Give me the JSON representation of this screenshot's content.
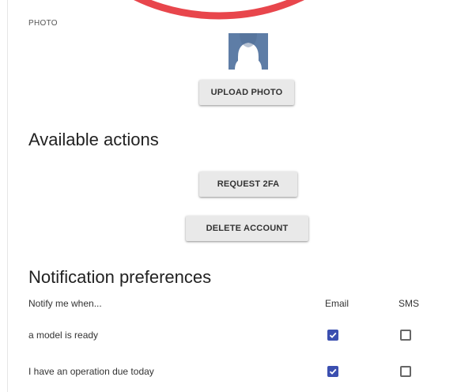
{
  "photo_section": {
    "label": "PHOTO",
    "avatar_icon": "person-silhouette-icon",
    "upload_label": "UPLOAD PHOTO"
  },
  "actions_section": {
    "heading": "Available actions",
    "request_2fa_label": "REQUEST 2FA",
    "delete_account_label": "DELETE ACCOUNT"
  },
  "notifications": {
    "heading": "Notification preferences",
    "columns": {
      "notify": "Notify me when...",
      "email": "Email",
      "sms": "SMS"
    },
    "rows": [
      {
        "label": "a model is ready",
        "email": true,
        "sms": false
      },
      {
        "label": "I have an operation due today",
        "email": true,
        "sms": false
      }
    ]
  },
  "colors": {
    "accent": "#3b4fb0",
    "avatar": "#5e7da6",
    "stamp": "#e8464c"
  }
}
